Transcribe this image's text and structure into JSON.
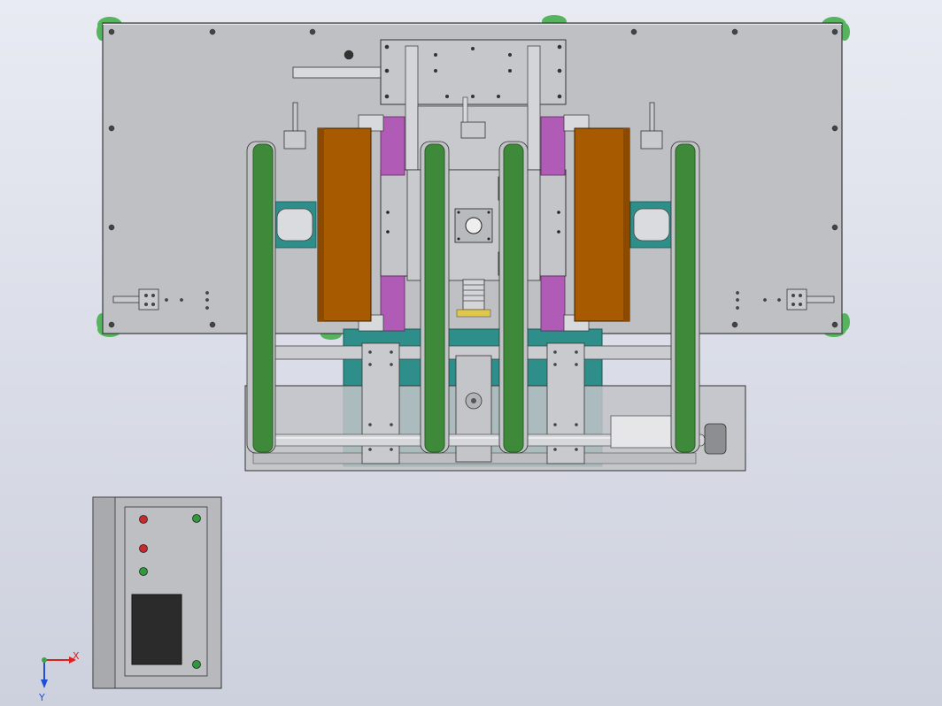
{
  "view": {
    "background_top": "#e9ebf3",
    "background_bottom": "#cdd1dd"
  },
  "colors": {
    "base_plate": "#bfc0c4",
    "plate_edge": "#3a3a3a",
    "steel": "#c9cacd",
    "steel_dark": "#9c9da1",
    "belt_green": "#3f8a3a",
    "belt_green_dark": "#2a5f27",
    "foot_green": "#56b45e",
    "roller_orange": "#a85a00",
    "bracket_magenta": "#b05cb6",
    "frame_teal": "#2e8f8a",
    "panel_grey": "#b8b9bd",
    "screen_black": "#2b2b2b",
    "lamp_red": "#c8292b",
    "lamp_green": "#2f9a3c"
  },
  "control_box": {
    "indicator_lamps": [
      {
        "name": "lamp-red-1",
        "color": "red"
      },
      {
        "name": "lamp-red-2",
        "color": "red"
      },
      {
        "name": "lamp-green-1",
        "color": "green"
      },
      {
        "name": "lamp-green-top-right",
        "color": "green"
      },
      {
        "name": "lamp-green-bottom-right",
        "color": "green"
      }
    ],
    "display": "hmi-screen"
  },
  "axis_triad": {
    "x_label": "X",
    "y_label": "Y",
    "x_color": "#e02020",
    "y_color": "#1f4fd6"
  }
}
